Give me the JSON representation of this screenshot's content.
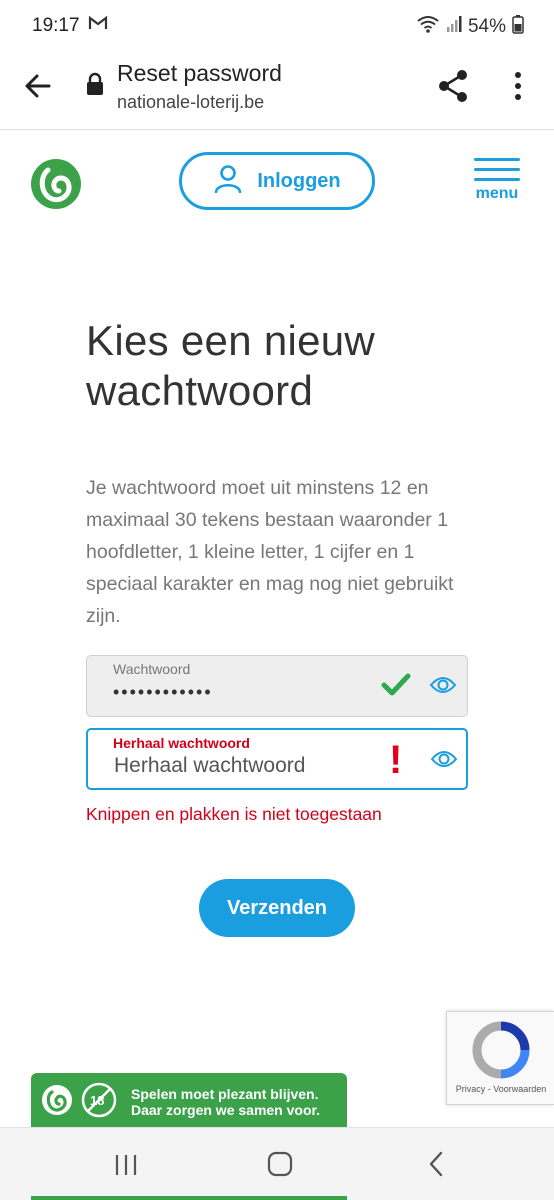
{
  "status_bar": {
    "time": "19:17",
    "battery": "54%"
  },
  "browser": {
    "page_title": "Reset password",
    "domain": "nationale-loterij.be"
  },
  "header": {
    "login_label": "Inloggen",
    "menu_label": "menu"
  },
  "main": {
    "title": "Kies een nieuw wachtwoord",
    "description": "Je wachtwoord moet uit minstens 12 en maximaal 30 tekens bestaan waaronder 1 hoofdletter, 1 kleine letter, 1 cijfer en 1 speciaal karakter en mag nog niet gebruikt zijn.",
    "password_field": {
      "label": "Wachtwoord",
      "value": "••••••••••••"
    },
    "repeat_field": {
      "label": "Herhaal wachtwoord",
      "placeholder": "Herhaal wachtwoord"
    },
    "error_message": "Knippen en plakken is niet toegestaan",
    "submit_label": "Verzenden"
  },
  "recaptcha": {
    "links": "Privacy - Voorwaarden"
  },
  "banner": {
    "age": "18",
    "line1": "Spelen moet plezant blijven.",
    "line2": "Daar zorgen we samen voor."
  },
  "colors": {
    "brand_blue": "#1a9ee0",
    "brand_green": "#3ca24a",
    "error_red": "#d0021b"
  }
}
